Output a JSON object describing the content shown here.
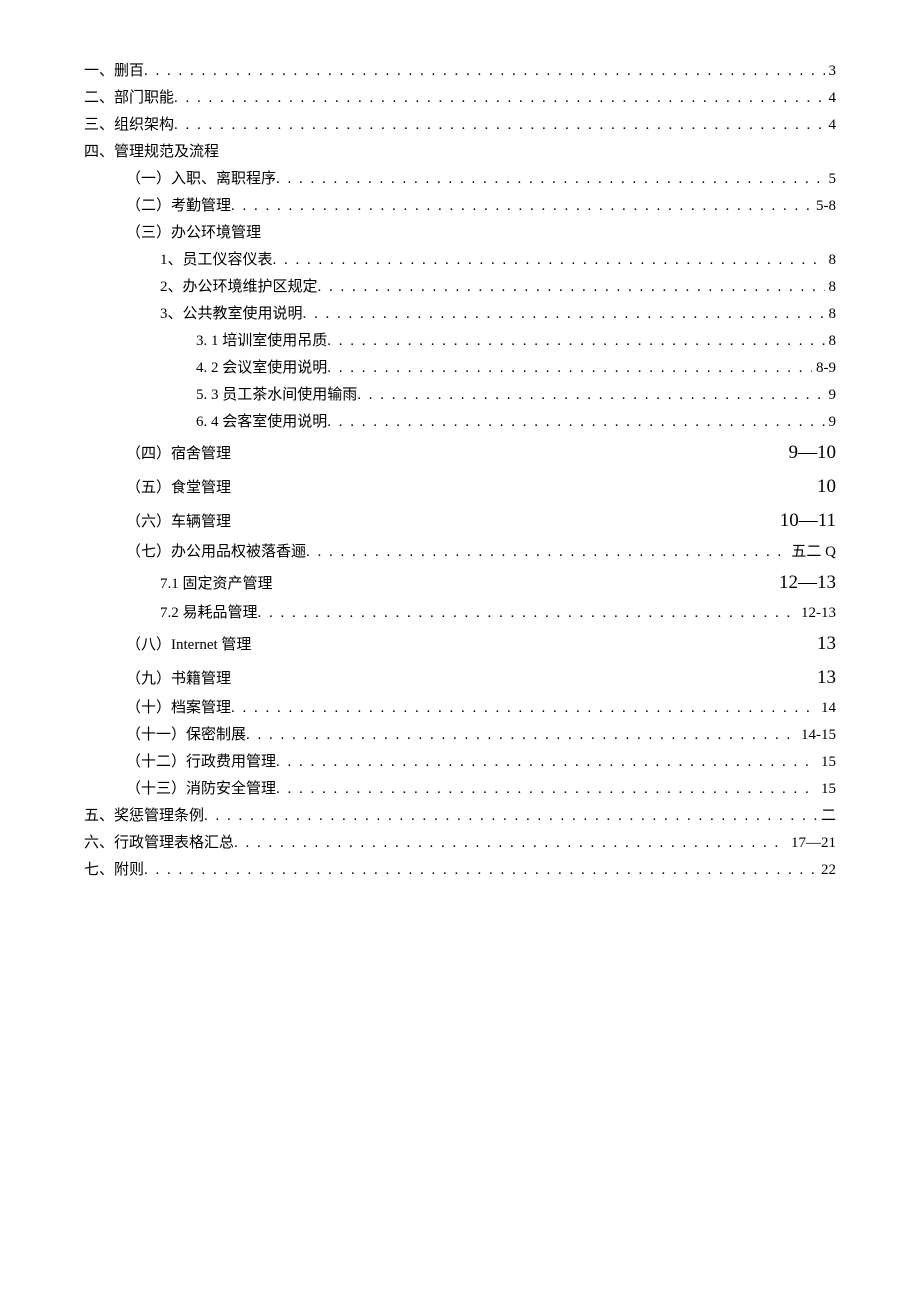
{
  "toc": [
    {
      "indent": 0,
      "label": "一、删百",
      "page": "3",
      "leader": true,
      "largePage": false
    },
    {
      "indent": 0,
      "label": "二、部门职能",
      "page": "4",
      "leader": true,
      "largePage": false
    },
    {
      "indent": 0,
      "label": "三、组织架构",
      "page": "4",
      "leader": true,
      "largePage": false
    },
    {
      "indent": 0,
      "label": "四、管理规范及流程",
      "page": "",
      "leader": false,
      "largePage": false
    },
    {
      "indent": 1,
      "label": "（一）入职、离职程序",
      "page": "5",
      "leader": true,
      "largePage": false
    },
    {
      "indent": 1,
      "label": "（二）考勤管理",
      "page": "5-8",
      "leader": true,
      "largePage": false
    },
    {
      "indent": 1,
      "label": "（三）办公环境管理",
      "page": "",
      "leader": false,
      "largePage": false
    },
    {
      "indent": 2,
      "label": "1、员工仪容仪表",
      "page": "8",
      "leader": true,
      "largePage": false
    },
    {
      "indent": 2,
      "label": "2、办公环境维护区规定",
      "page": "8",
      "leader": true,
      "largePage": false
    },
    {
      "indent": 2,
      "label": "3、公共教室使用说明",
      "page": "8",
      "leader": true,
      "largePage": false
    },
    {
      "indent": 3,
      "label": "3.   1 培训室使用吊质",
      "page": "8",
      "leader": true,
      "largePage": false,
      "numSerif": true
    },
    {
      "indent": 3,
      "label": "4.   2 会议室使用说明",
      "page": "8-9",
      "leader": true,
      "largePage": false,
      "numSerif": true
    },
    {
      "indent": 3,
      "label": "5.   3 员工茶水间使用输雨",
      "page": "9",
      "leader": true,
      "largePage": false,
      "numSerif": true
    },
    {
      "indent": 3,
      "label": "6.   4 会客室使用说明",
      "page": "9",
      "leader": true,
      "largePage": false,
      "numSerif": true
    },
    {
      "indent": 1,
      "label": "（四）宿舍管理",
      "page": "9—10",
      "leader": false,
      "largePage": true
    },
    {
      "indent": 1,
      "label": "（五）食堂管理",
      "page": "10",
      "leader": false,
      "largePage": true
    },
    {
      "indent": 1,
      "label": "（六）车辆管理",
      "page": "10—11",
      "leader": false,
      "largePage": true
    },
    {
      "indent": 1,
      "label": "（七）办公用品权被落香逦",
      "page": "五二 Q",
      "leader": true,
      "largePage": false
    },
    {
      "indent": 2,
      "label": "7.1 固定资产管理",
      "page": "12—13",
      "leader": false,
      "largePage": true,
      "numSerif": true
    },
    {
      "indent": 2,
      "label": "7.2 易耗品管理",
      "page": "12-13",
      "leader": true,
      "largePage": false,
      "numSerif": true
    },
    {
      "indent": 1,
      "label": "（八）Internet 管理",
      "page": "13",
      "leader": false,
      "largePage": true,
      "mixed": true
    },
    {
      "indent": 1,
      "label": "（九）书籍管理",
      "page": "13",
      "leader": false,
      "largePage": true
    },
    {
      "indent": 1,
      "label": "（十）档案管理",
      "page": "14",
      "leader": true,
      "largePage": false
    },
    {
      "indent": 1,
      "label": "（十一）保密制展",
      "page": "14-15",
      "leader": true,
      "largePage": false
    },
    {
      "indent": 1,
      "label": "（十二）行政费用管理",
      "page": "15",
      "leader": true,
      "largePage": false
    },
    {
      "indent": 1,
      "label": "（十三）消防安全管理",
      "page": "15",
      "leader": true,
      "largePage": false
    },
    {
      "indent": 0,
      "label": "五、奖惩管理条例",
      "page": "二",
      "leader": true,
      "largePage": false
    },
    {
      "indent": 0,
      "label": "六、行政管理表格汇总",
      "page": "17—21",
      "leader": true,
      "largePage": false
    },
    {
      "indent": 0,
      "label": "七、附则",
      "page": "22",
      "leader": true,
      "largePage": false
    }
  ]
}
